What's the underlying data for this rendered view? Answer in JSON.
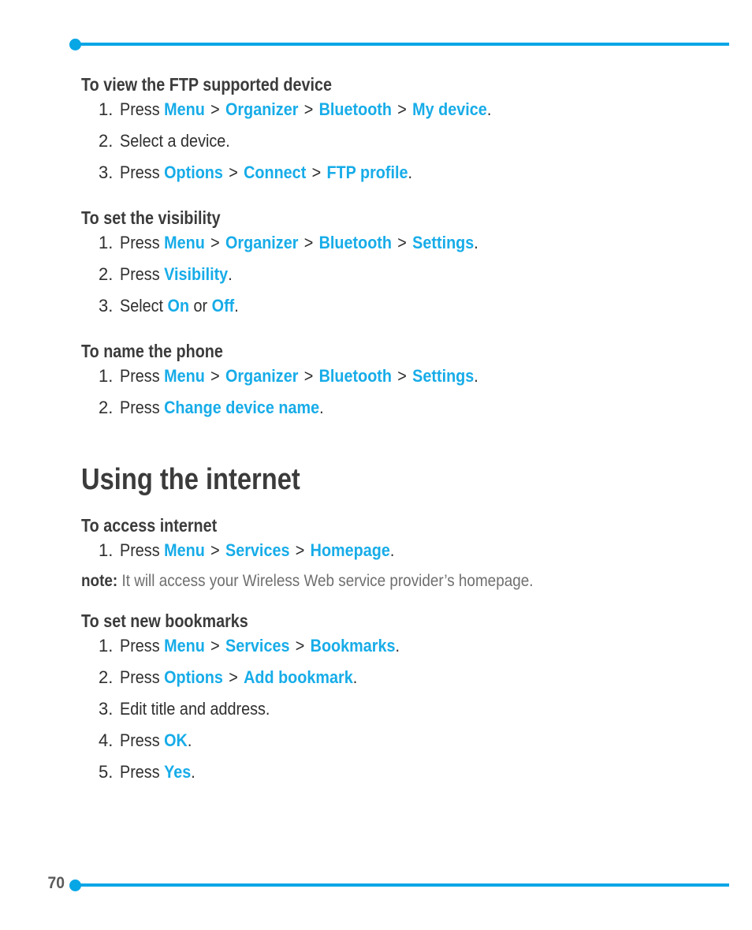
{
  "page": {
    "number": "70",
    "accent_color": "#07a6e5",
    "link_color": "#17ace8",
    "text_color": "#2f2f2f",
    "heading_color": "#3b3b3b",
    "note_color": "#6f6f6f"
  },
  "sections": [
    {
      "heading": "To view the FTP supported device",
      "steps": [
        {
          "num": "1.",
          "parts": [
            {
              "text": "Press ",
              "style": "plain"
            },
            {
              "text": "Menu",
              "style": "link"
            },
            {
              "text": " > ",
              "style": "sep"
            },
            {
              "text": "Organizer",
              "style": "link"
            },
            {
              "text": " > ",
              "style": "sep"
            },
            {
              "text": "Bluetooth",
              "style": "link"
            },
            {
              "text": " > ",
              "style": "sep"
            },
            {
              "text": "My device",
              "style": "link"
            },
            {
              "text": ".",
              "style": "plain"
            }
          ]
        },
        {
          "num": "2.",
          "parts": [
            {
              "text": "Select a device.",
              "style": "plain"
            }
          ]
        },
        {
          "num": "3.",
          "parts": [
            {
              "text": "Press ",
              "style": "plain"
            },
            {
              "text": "Options",
              "style": "link"
            },
            {
              "text": " > ",
              "style": "sep"
            },
            {
              "text": "Connect",
              "style": "link"
            },
            {
              "text": " > ",
              "style": "sep"
            },
            {
              "text": "FTP profile",
              "style": "link"
            },
            {
              "text": ".",
              "style": "plain"
            }
          ]
        }
      ]
    },
    {
      "heading": "To set the visibility",
      "steps": [
        {
          "num": "1.",
          "parts": [
            {
              "text": "Press ",
              "style": "plain"
            },
            {
              "text": "Menu",
              "style": "link"
            },
            {
              "text": " > ",
              "style": "sep"
            },
            {
              "text": "Organizer",
              "style": "link"
            },
            {
              "text": " > ",
              "style": "sep"
            },
            {
              "text": "Bluetooth",
              "style": "link"
            },
            {
              "text": " > ",
              "style": "sep"
            },
            {
              "text": "Settings",
              "style": "link"
            },
            {
              "text": ".",
              "style": "plain"
            }
          ]
        },
        {
          "num": "2.",
          "parts": [
            {
              "text": "Press ",
              "style": "plain"
            },
            {
              "text": "Visibility",
              "style": "link"
            },
            {
              "text": ".",
              "style": "plain"
            }
          ]
        },
        {
          "num": "3.",
          "parts": [
            {
              "text": "Select ",
              "style": "plain"
            },
            {
              "text": "On",
              "style": "link"
            },
            {
              "text": " or ",
              "style": "plain"
            },
            {
              "text": "Off",
              "style": "link"
            },
            {
              "text": ".",
              "style": "plain"
            }
          ]
        }
      ]
    },
    {
      "heading": "To name the phone",
      "steps": [
        {
          "num": "1.",
          "parts": [
            {
              "text": "Press ",
              "style": "plain"
            },
            {
              "text": "Menu",
              "style": "link"
            },
            {
              "text": " > ",
              "style": "sep"
            },
            {
              "text": "Organizer",
              "style": "link"
            },
            {
              "text": " > ",
              "style": "sep"
            },
            {
              "text": "Bluetooth",
              "style": "link"
            },
            {
              "text": " > ",
              "style": "sep"
            },
            {
              "text": "Settings",
              "style": "link"
            },
            {
              "text": ".",
              "style": "plain"
            }
          ]
        },
        {
          "num": "2.",
          "parts": [
            {
              "text": "Press ",
              "style": "plain"
            },
            {
              "text": "Change device name",
              "style": "link"
            },
            {
              "text": ".",
              "style": "plain"
            }
          ]
        }
      ]
    }
  ],
  "chapter": {
    "heading": "Using the internet"
  },
  "sections_after_chapter": [
    {
      "heading": "To access internet",
      "steps": [
        {
          "num": "1.",
          "parts": [
            {
              "text": "Press ",
              "style": "plain"
            },
            {
              "text": "Menu",
              "style": "link"
            },
            {
              "text": " > ",
              "style": "sep"
            },
            {
              "text": "Services",
              "style": "link"
            },
            {
              "text": " > ",
              "style": "sep"
            },
            {
              "text": "Homepage",
              "style": "link"
            },
            {
              "text": ".",
              "style": "plain"
            }
          ]
        }
      ],
      "note": {
        "label": "note:",
        "text": " It will access your Wireless Web service provider’s homepage."
      }
    },
    {
      "heading": "To set new bookmarks",
      "steps": [
        {
          "num": "1.",
          "parts": [
            {
              "text": "Press ",
              "style": "plain"
            },
            {
              "text": "Menu",
              "style": "link"
            },
            {
              "text": " > ",
              "style": "sep"
            },
            {
              "text": "Services",
              "style": "link"
            },
            {
              "text": " > ",
              "style": "sep"
            },
            {
              "text": "Bookmarks",
              "style": "link"
            },
            {
              "text": ".",
              "style": "plain"
            }
          ]
        },
        {
          "num": "2.",
          "parts": [
            {
              "text": "Press ",
              "style": "plain"
            },
            {
              "text": "Options",
              "style": "link"
            },
            {
              "text": " > ",
              "style": "sep"
            },
            {
              "text": "Add bookmark",
              "style": "link"
            },
            {
              "text": ".",
              "style": "plain"
            }
          ]
        },
        {
          "num": "3.",
          "parts": [
            {
              "text": "Edit title and address.",
              "style": "plain"
            }
          ]
        },
        {
          "num": "4.",
          "parts": [
            {
              "text": "Press ",
              "style": "plain"
            },
            {
              "text": "OK",
              "style": "link"
            },
            {
              "text": ".",
              "style": "plain"
            }
          ]
        },
        {
          "num": "5.",
          "parts": [
            {
              "text": "Press ",
              "style": "plain"
            },
            {
              "text": "Yes",
              "style": "link"
            },
            {
              "text": ".",
              "style": "plain"
            }
          ]
        }
      ]
    }
  ]
}
